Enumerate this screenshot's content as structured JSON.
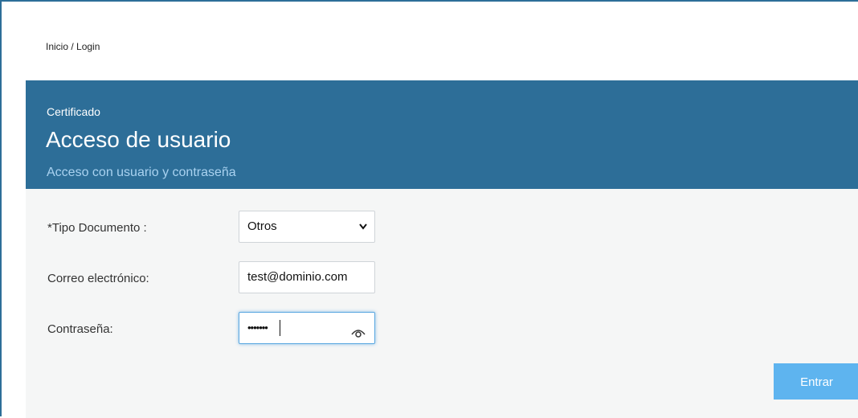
{
  "breadcrumb": "Inicio / Login",
  "header": {
    "kicker": "Certificado",
    "title": "Acceso de usuario",
    "subtitle": "Acceso con usuario y contraseña"
  },
  "form": {
    "doc_type_label": "*Tipo Documento :",
    "doc_type_value": "Otros",
    "email_label": "Correo electrónico:",
    "email_value": "test@dominio.com",
    "password_label": "Contraseña:",
    "password_value": "•••••••",
    "submit_label": "Entrar"
  },
  "icons": {
    "select": "chevron-down-icon",
    "password_toggle": "eye-icon"
  },
  "colors": {
    "primary": "#2d6e98",
    "subtitle": "#a9d2f0",
    "button": "#5eb4ef",
    "form_bg": "#f5f6f6"
  }
}
